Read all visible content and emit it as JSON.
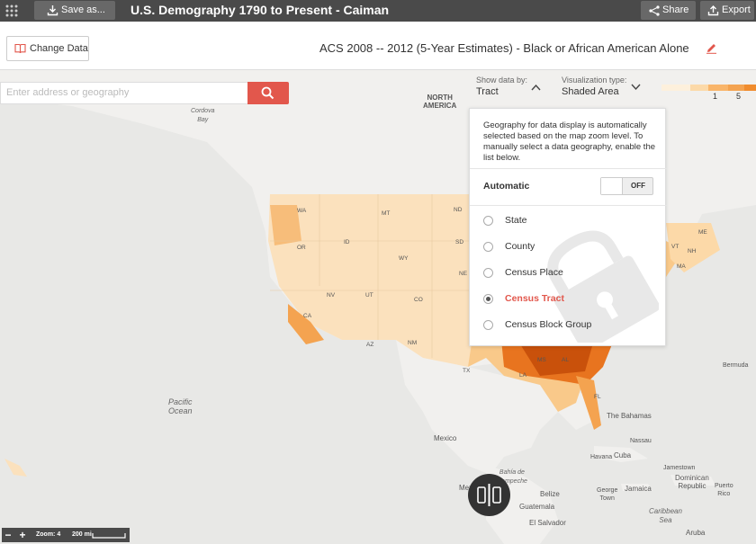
{
  "topbar": {
    "save_label": "Save as...",
    "title": "U.S. Demography 1790 to Present - Caiman",
    "share_label": "Share",
    "export_label": "Export"
  },
  "header": {
    "change_data_label": "Change Data",
    "dataset_title": "ACS 2008 -- 2012 (5-Year Estimates) - Black or African American Alone"
  },
  "search": {
    "placeholder": "Enter address or geography"
  },
  "controls": {
    "show_data_by_label": "Show data by:",
    "show_data_by_value": "Tract",
    "viz_type_label": "Visualization type:",
    "viz_type_value": "Shaded Area"
  },
  "legend": {
    "ticks": [
      "1",
      "5"
    ],
    "colors": [
      "#fdf0dc",
      "#fcd9a8",
      "#f9b56a",
      "#f08c2e",
      "#d95f0e"
    ]
  },
  "geography_popover": {
    "description": "Geography for data display is automatically selected based on the map zoom level. To manually select a data geography, enable the list below.",
    "automatic_label": "Automatic",
    "toggle_state": "OFF",
    "options": [
      {
        "label": "State",
        "selected": false
      },
      {
        "label": "County",
        "selected": false
      },
      {
        "label": "Census Place",
        "selected": false
      },
      {
        "label": "Census Tract",
        "selected": true
      },
      {
        "label": "Census Block Group",
        "selected": false
      }
    ]
  },
  "map_labels": {
    "north_america": "NORTH\nAMERICA",
    "cordova_bay": "Cordova\nBay",
    "pacific_ocean": "Pacific\nOcean",
    "mexico": "Mexico",
    "bermuda": "Bermuda",
    "bahamas": "The Bahamas",
    "nassau": "Nassau",
    "havana": "Havana",
    "cuba": "Cuba",
    "jamestown": "Jamestown",
    "dominican_republic": "Dominican\nRepublic",
    "puerto_rico": "Puerto\nRico",
    "george_town": "George\nTown",
    "jamaica": "Jamaica",
    "caribbean_sea": "Caribbean\nSea",
    "belize": "Belize",
    "guatemala": "Guatemala",
    "el_salvador": "El Salvador",
    "aruba": "Aruba",
    "bahia": "Bahía de\nCampeche",
    "mex_city": "Mex",
    "states": [
      "WA",
      "OR",
      "ID",
      "MT",
      "ND",
      "SD",
      "WY",
      "NE",
      "NV",
      "UT",
      "CO",
      "CA",
      "AZ",
      "NM",
      "TX",
      "FL",
      "VT",
      "NH",
      "ME",
      "MA",
      "MS",
      "AL",
      "LA"
    ]
  },
  "zoom": {
    "zoom_text": "Zoom: 4",
    "scale_text": "200 mi"
  },
  "colors": {
    "accent": "#e2574c",
    "topbar": "#4a4a4a"
  }
}
